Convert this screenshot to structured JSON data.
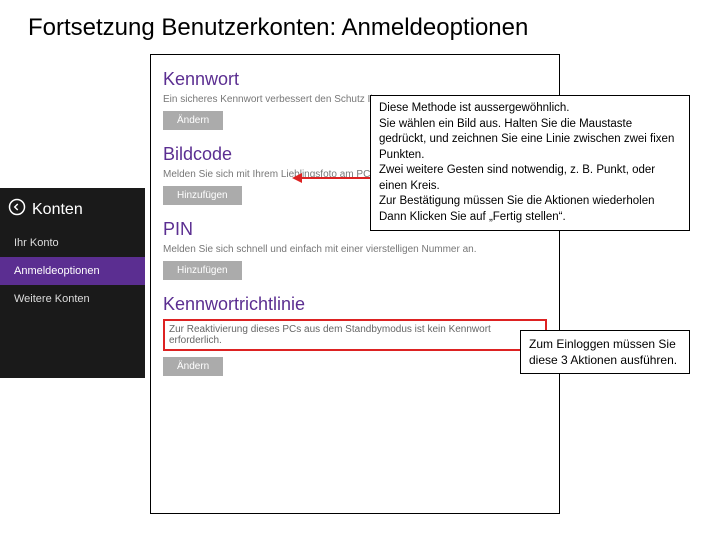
{
  "title": "Fortsetzung Benutzerkonten: Anmeldeoptionen",
  "sidebar": {
    "header": "Konten",
    "items": [
      {
        "label": "Ihr Konto"
      },
      {
        "label": "Anmeldeoptionen"
      },
      {
        "label": "Weitere Konten"
      }
    ]
  },
  "panel": {
    "kennwort": {
      "title": "Kennwort",
      "sub": "Ein sicheres Kennwort verbessert den Schutz Ihres Kontos",
      "button": "Ändern"
    },
    "bildcode": {
      "title": "Bildcode",
      "sub": "Melden Sie sich mit Ihrem Lieblingsfoto am PC an.",
      "button": "Hinzufügen"
    },
    "pin": {
      "title": "PIN",
      "sub": "Melden Sie sich schnell und einfach mit einer vierstelligen Nummer an.",
      "button": "Hinzufügen"
    },
    "richtlinie": {
      "title": "Kennwortrichtlinie",
      "highlight": "Zur Reaktivierung dieses PCs aus dem Standbymodus ist kein Kennwort erforderlich.",
      "button": "Ändern"
    }
  },
  "annotations": {
    "large": "Diese Methode ist aussergewöhnlich.\nSie wählen ein Bild aus. Halten Sie die Maustaste gedrückt, und zeichnen Sie eine Linie zwischen zwei fixen Punkten.\nZwei weitere Gesten sind notwendig, z. B. Punkt, oder einen Kreis.\nZur Bestätigung müssen Sie die Aktionen wiederholen\nDann Klicken Sie auf „Fertig stellen“.",
    "small": "Zum Einloggen müssen Sie diese 3 Aktionen ausführen."
  }
}
